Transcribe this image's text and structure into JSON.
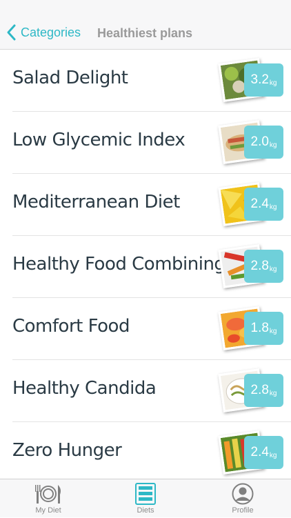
{
  "navbar": {
    "back_label": "Categories",
    "title": "Healthiest plans"
  },
  "diets": [
    {
      "name": "Salad Delight",
      "value": "3.2",
      "unit": "kg",
      "image": "salad-thumbnail"
    },
    {
      "name": "Low Glycemic Index",
      "value": "2.0",
      "unit": "kg",
      "image": "wrap-thumbnail"
    },
    {
      "name": "Mediterranean Diet",
      "value": "2.4",
      "unit": "kg",
      "image": "fruit-thumbnail"
    },
    {
      "name": "Healthy Food Combining",
      "value": "2.8",
      "unit": "kg",
      "image": "vegetables-thumbnail"
    },
    {
      "name": "Comfort Food",
      "value": "1.8",
      "unit": "kg",
      "image": "shrimp-thumbnail"
    },
    {
      "name": "Healthy Candida",
      "value": "2.8",
      "unit": "kg",
      "image": "pasta-thumbnail"
    },
    {
      "name": "Zero Hunger",
      "value": "2.4",
      "unit": "kg",
      "image": "veggie-sticks-thumbnail"
    }
  ],
  "tabbar": {
    "tabs": [
      {
        "label": "My Diet",
        "icon": "plate-cutlery-icon"
      },
      {
        "label": "Diets",
        "icon": "list-icon",
        "active": true
      },
      {
        "label": "Profile",
        "icon": "user-icon"
      }
    ]
  },
  "colors": {
    "accent": "#2db8c6",
    "badge": "#6fd0da",
    "text": "#2a3a44"
  }
}
